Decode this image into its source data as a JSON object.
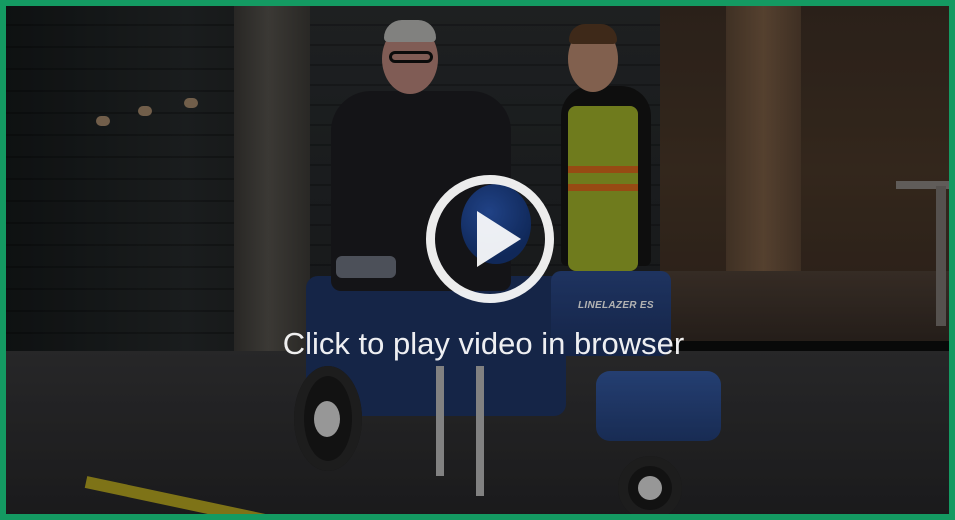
{
  "video_player": {
    "caption": "Click to play video in browser",
    "play_icon": "play-icon",
    "accent_color": "#149a62"
  },
  "video_frame": {
    "machine_label": "LINELAZER ES"
  }
}
